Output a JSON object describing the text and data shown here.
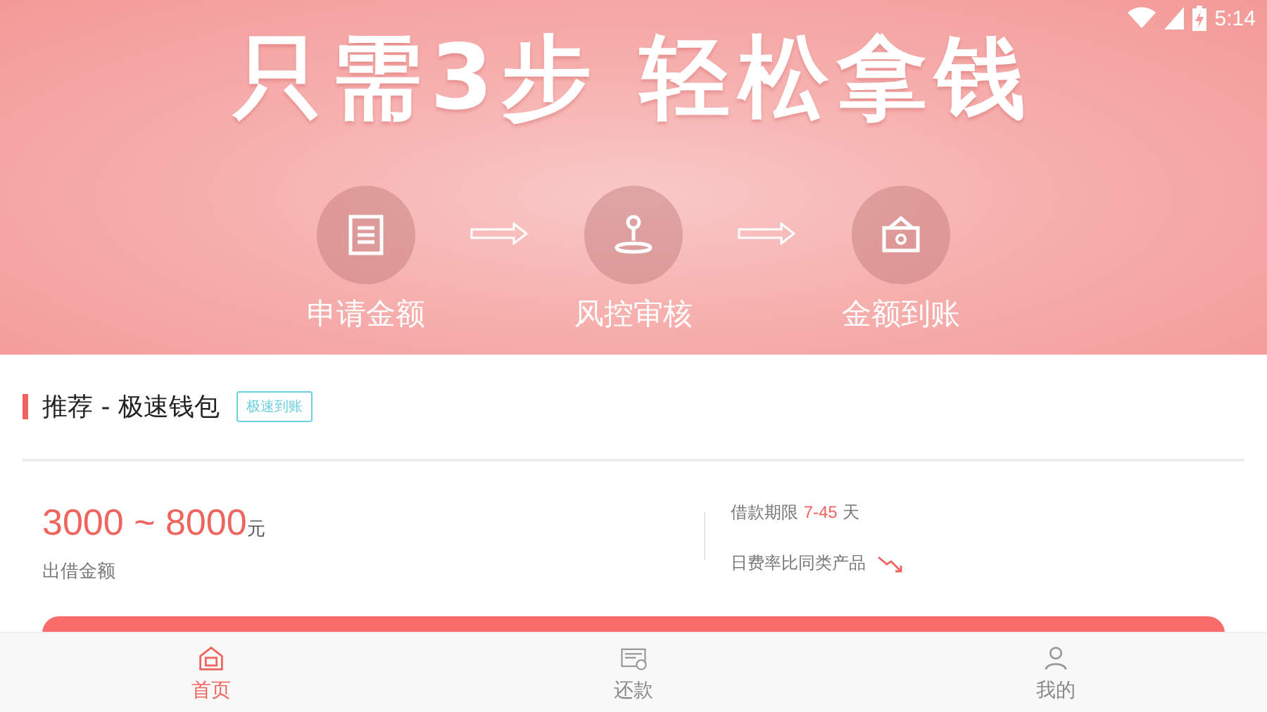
{
  "status_bar": {
    "time": "5:14"
  },
  "banner": {
    "headline": "只需3步 轻松拿钱",
    "steps": [
      {
        "kind": "form",
        "label": "申请金额"
      },
      {
        "kind": "stamp",
        "label": "风控审核"
      },
      {
        "kind": "wallet",
        "label": "金额到账"
      }
    ]
  },
  "product": {
    "title": "推荐 - 极速钱包",
    "tag": "极速到账",
    "amount": "3000 ~ 8000",
    "amount_unit": "元",
    "amount_label": "出借金额",
    "term_label": "借款期限",
    "term_value": "7-45",
    "term_unit": "天",
    "rate_label": "日费率比同类产品"
  },
  "tabs": [
    {
      "kind": "home",
      "label": "首页",
      "selected": true
    },
    {
      "kind": "repay",
      "label": "还款",
      "selected": false
    },
    {
      "kind": "me",
      "label": "我的",
      "selected": false
    }
  ]
}
